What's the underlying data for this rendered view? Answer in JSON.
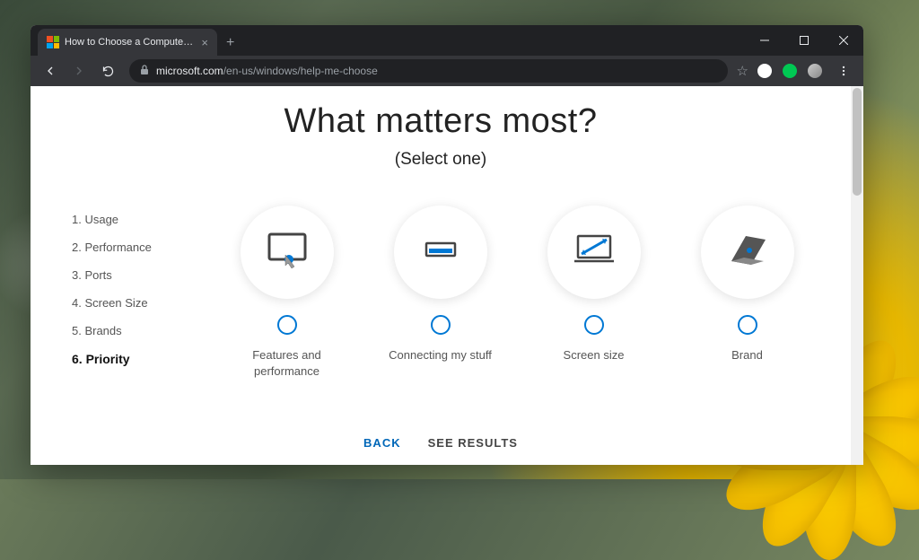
{
  "browser": {
    "tab_title": "How to Choose a Computer: Fin",
    "url_domain": "microsoft.com",
    "url_path": "/en-us/windows/help-me-choose"
  },
  "page": {
    "heading": "What matters most?",
    "subheading": "(Select one)"
  },
  "sidebar": {
    "items": [
      {
        "label": "1. Usage",
        "active": false
      },
      {
        "label": "2. Performance",
        "active": false
      },
      {
        "label": "3. Ports",
        "active": false
      },
      {
        "label": "4. Screen Size",
        "active": false
      },
      {
        "label": "5. Brands",
        "active": false
      },
      {
        "label": "6. Priority",
        "active": true
      }
    ]
  },
  "options": [
    {
      "label": "Features and performance",
      "icon": "touch-device-icon"
    },
    {
      "label": "Connecting my stuff",
      "icon": "port-slot-icon"
    },
    {
      "label": "Screen size",
      "icon": "screen-diagonal-icon"
    },
    {
      "label": "Brand",
      "icon": "laptop-icon"
    }
  ],
  "actions": {
    "back": "BACK",
    "results": "SEE RESULTS"
  }
}
